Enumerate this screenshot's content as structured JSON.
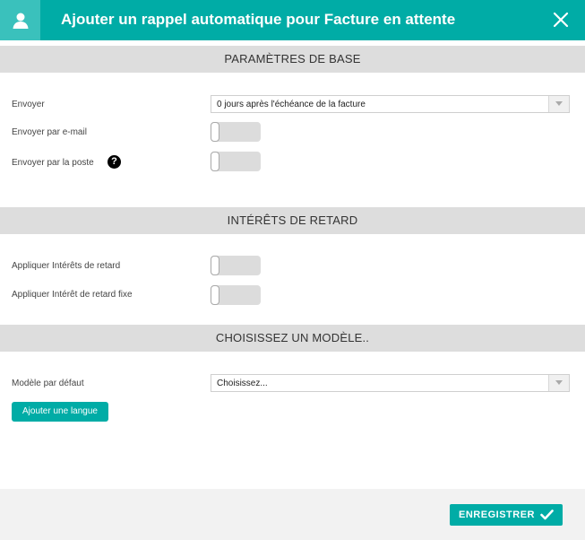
{
  "header": {
    "title": "Ajouter un rappel automatique pour Facture en attente",
    "avatar_icon": "user-icon",
    "close_icon": "close-icon"
  },
  "sections": {
    "basic": {
      "title": "PARAMÈTRES DE BASE",
      "send_label": "Envoyer",
      "send_value": "0 jours après l'échéance de la facture",
      "email_label": "Envoyer par e-mail",
      "post_label": "Envoyer par la poste",
      "help_glyph": "?"
    },
    "interest": {
      "title": "INTÉRÊTS DE RETARD",
      "apply_label": "Appliquer Intérêts de retard",
      "fixed_label": "Appliquer Intérêt de retard fixe"
    },
    "template": {
      "title": "CHOISISSEZ UN MODÈLE..",
      "default_label": "Modèle par défaut",
      "default_value": "Choisissez...",
      "add_language": "Ajouter une langue"
    }
  },
  "footer": {
    "save_label": "ENREGISTRER",
    "save_icon": "check-icon"
  },
  "colors": {
    "accent": "#00aca6",
    "accent_light": "#3ac1bc",
    "section_bg": "#dddddd",
    "footer_bg": "#f2f2f2"
  },
  "toggles": {
    "email": false,
    "post": false,
    "late_interest": false,
    "fixed_interest": false
  }
}
